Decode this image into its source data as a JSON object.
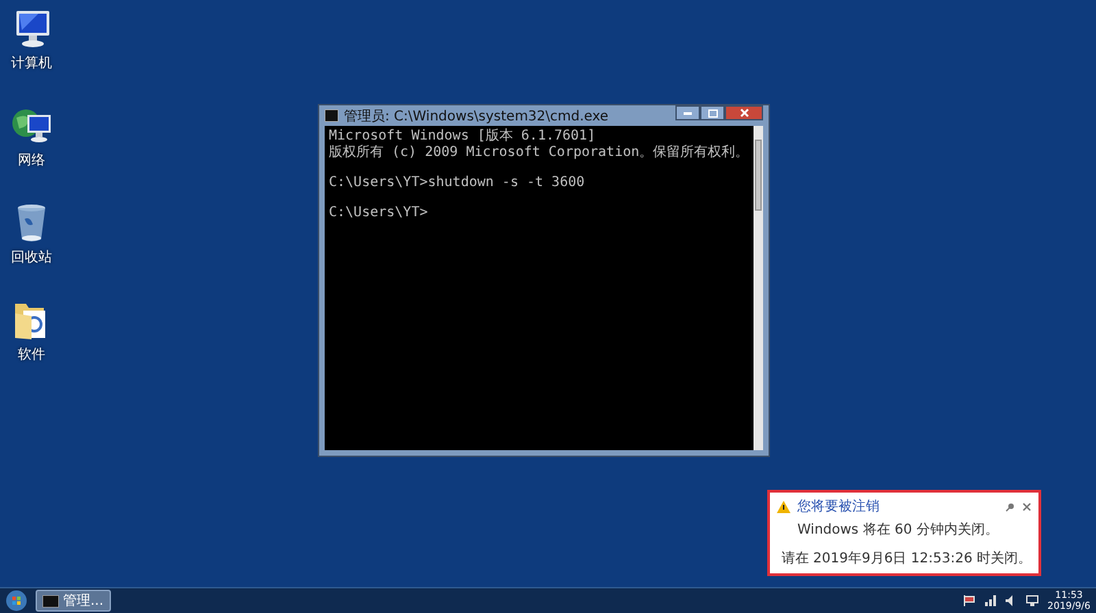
{
  "desktop_icons": [
    {
      "label": "计算机",
      "kind": "computer"
    },
    {
      "label": "网络",
      "kind": "network"
    },
    {
      "label": "回收站",
      "kind": "recycle"
    },
    {
      "label": "软件",
      "kind": "folder"
    }
  ],
  "console_window": {
    "title": "管理员: C:\\Windows\\system32\\cmd.exe",
    "blocks": [
      [
        "Microsoft Windows [版本 6.1.7601]",
        "版权所有 (c) 2009 Microsoft Corporation。保留所有权利。"
      ],
      [
        "C:\\Users\\YT>shutdown -s -t 3600"
      ],
      [
        "C:\\Users\\YT>"
      ]
    ]
  },
  "notification": {
    "title": "您将要被注销",
    "message": "Windows 将在 60 分钟内关闭。",
    "detail": "请在 2019年9月6日 12:53:26 时关闭。"
  },
  "taskbar": {
    "buttons": [
      {
        "label": "管理..."
      }
    ],
    "clock": {
      "time": "11:53",
      "date": "2019/9/6"
    }
  }
}
